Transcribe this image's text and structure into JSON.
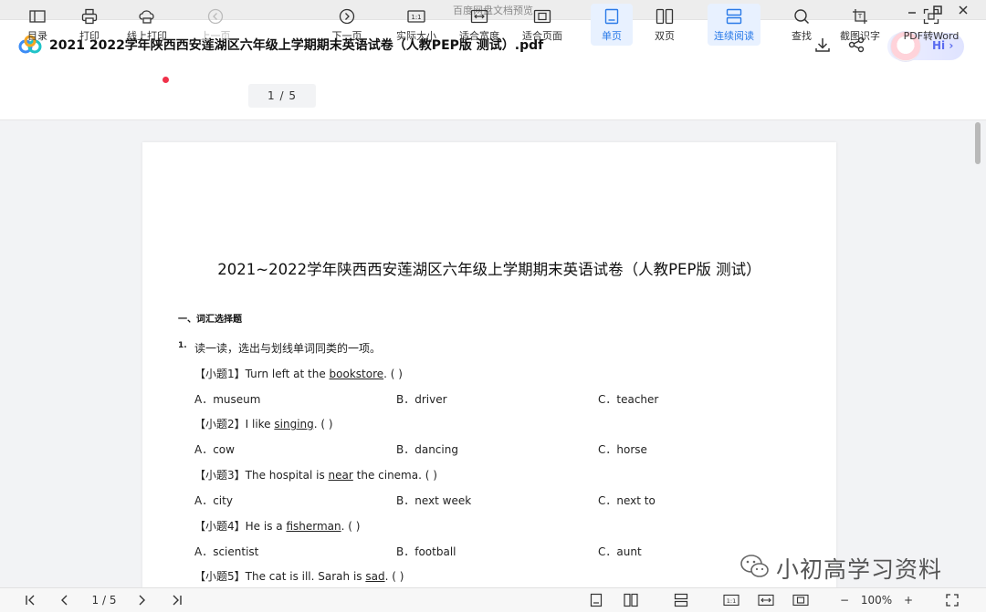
{
  "window": {
    "title": "百度网盘文档预览",
    "controls": [
      "minimize-icon",
      "maximize-icon",
      "close-icon"
    ]
  },
  "header": {
    "app_icon": "baidu-netdisk-logo",
    "file_name": "2021  2022学年陕西西安莲湖区六年级上学期期末英语试卷（人教PEP版 测试）.pdf",
    "download_icon": "download-icon",
    "share_icon": "share-icon",
    "assistant_label": "Hi"
  },
  "toolbar": {
    "items": [
      {
        "label": "目录",
        "icon": "toc-icon"
      },
      {
        "label": "打印",
        "icon": "printer-icon"
      },
      {
        "label": "线上打印",
        "icon": "cloud-print-icon"
      },
      {
        "label": "上一页",
        "icon": "prev-page-icon"
      },
      {
        "label": "下一页",
        "icon": "next-page-icon"
      },
      {
        "label": "实际大小",
        "icon": "actual-size-icon"
      },
      {
        "label": "适合宽度",
        "icon": "fit-width-icon"
      },
      {
        "label": "适合页面",
        "icon": "fit-page-icon"
      },
      {
        "label": "单页",
        "icon": "single-page-icon"
      },
      {
        "label": "双页",
        "icon": "double-page-icon"
      },
      {
        "label": "连续阅读",
        "icon": "continuous-read-icon"
      },
      {
        "label": "查找",
        "icon": "search-icon"
      },
      {
        "label": "截图识字",
        "icon": "screenshot-ocr-icon"
      },
      {
        "label": "PDF转Word",
        "icon": "pdf-to-word-icon"
      }
    ],
    "page_indicator": "1 / 5",
    "accent_color": "#2a7ae8"
  },
  "document": {
    "title": "2021~2022学年陕西西安莲湖区六年级上学期期末英语试卷（人教PEP版 测试）",
    "section": "一、词汇选择题",
    "question_number": "1.",
    "question_text": "读一读，选出与划线单词同类的一项。",
    "sub_questions": [
      {
        "prefix": "【小题1】Turn left at the ",
        "underlined": "bookstore",
        "suffix": ". (       )",
        "options": [
          "A．museum",
          "B．driver",
          "C．teacher"
        ]
      },
      {
        "prefix": "【小题2】I like ",
        "underlined": "singing",
        "suffix": ". (       )",
        "options": [
          "A．cow",
          "B．dancing",
          "C．horse"
        ]
      },
      {
        "prefix": "【小题3】The hospital is ",
        "underlined": "near",
        "suffix": " the cinema. (       )",
        "options": [
          "A．city",
          "B．next week",
          "C．next to"
        ]
      },
      {
        "prefix": "【小题4】He is a ",
        "underlined": "fisherman",
        "suffix": ". (       )",
        "options": [
          "A．scientist",
          "B．football",
          "C．aunt"
        ]
      },
      {
        "prefix": "【小题5】The cat is ill. Sarah is ",
        "underlined": "sad",
        "suffix": ". (       )",
        "options": []
      }
    ]
  },
  "watermark": {
    "icon": "wechat-icon",
    "text": "小初高学习资料"
  },
  "statusbar": {
    "first_icon": "first-page-icon",
    "prev_icon": "prev-icon",
    "page_indicator": "1 / 5",
    "next_icon": "next-icon",
    "last_icon": "last-page-icon",
    "zoom": "100%",
    "zoom_out": "−",
    "zoom_in": "+"
  }
}
